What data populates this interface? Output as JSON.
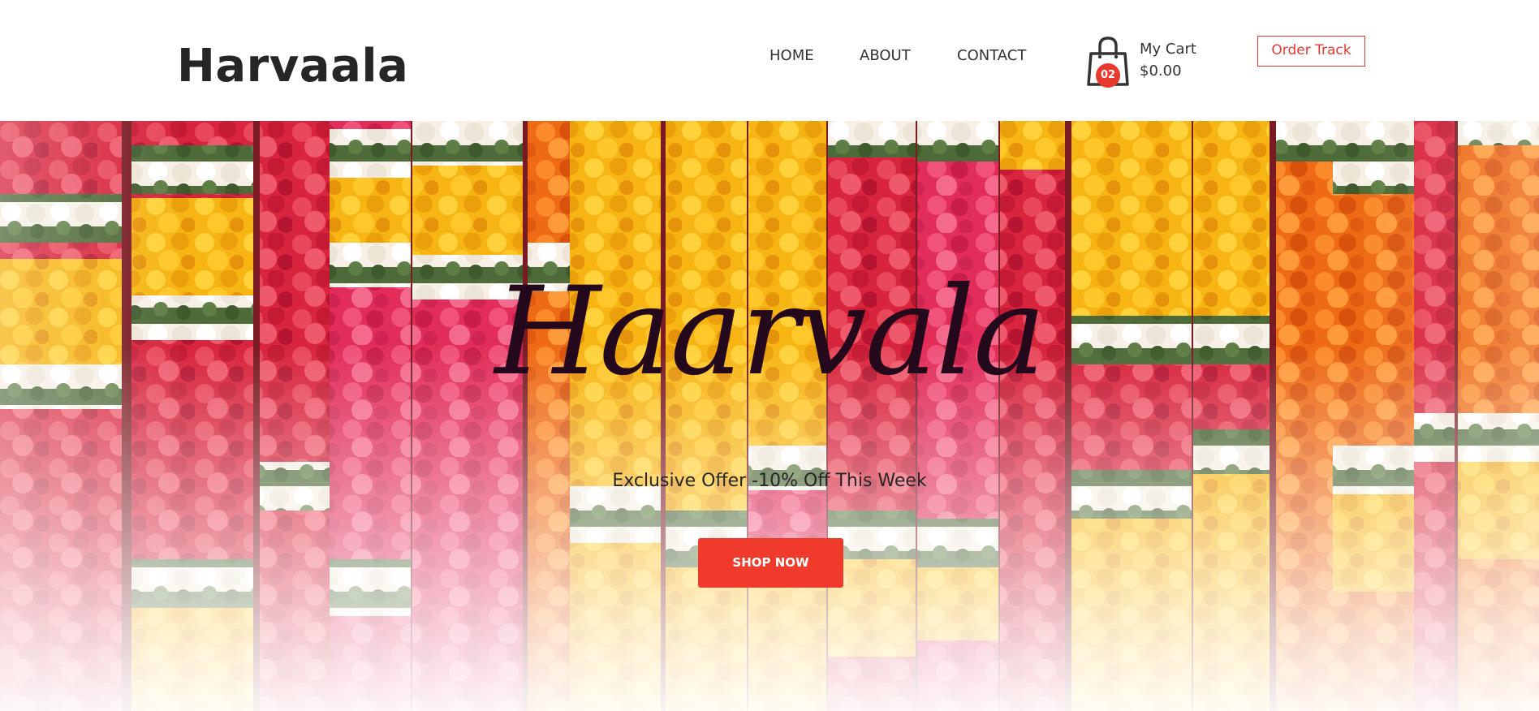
{
  "header": {
    "logo": "Harvaala",
    "nav": [
      {
        "label": "HOME"
      },
      {
        "label": "ABOUT"
      },
      {
        "label": "CONTACT"
      }
    ],
    "cart": {
      "icon": "shopping-bag-icon",
      "count": "02",
      "label": "My Cart",
      "total": "$0.00"
    },
    "order_track_label": "Order Track"
  },
  "hero": {
    "title": "Haarvala",
    "subtitle": "Exclusive Offer -10% Off This Week",
    "cta_label": "SHOP NOW",
    "image": "flower-garlands-background"
  },
  "colors": {
    "accent": "#f03a2c",
    "title": "#24091c",
    "text": "#333333"
  }
}
